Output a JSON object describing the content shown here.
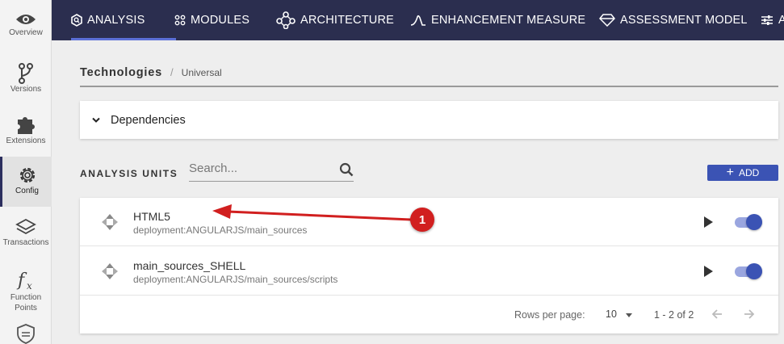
{
  "sidebar": {
    "items": [
      {
        "label": "Overview",
        "icon": "eye-icon"
      },
      {
        "label": "Versions",
        "icon": "branch-icon"
      },
      {
        "label": "Extensions",
        "icon": "puzzle-icon"
      },
      {
        "label": "Config",
        "icon": "gear-icon",
        "active": true
      },
      {
        "label": "Transactions",
        "icon": "layers-icon"
      },
      {
        "label": "Function Points",
        "icon": "fx-icon"
      }
    ]
  },
  "topnav": {
    "tabs": [
      {
        "label": "ANALYSIS",
        "icon": "analysis-icon",
        "active": true
      },
      {
        "label": "MODULES",
        "icon": "modules-icon"
      },
      {
        "label": "ARCHITECTURE",
        "icon": "architecture-icon"
      },
      {
        "label": "ENHANCEMENT MEASURE",
        "icon": "curve-icon"
      },
      {
        "label": "ASSESSMENT MODEL",
        "icon": "diamond-icon"
      },
      {
        "label": "A",
        "icon": "sliders-icon"
      }
    ]
  },
  "breadcrumb": {
    "main": "Technologies",
    "separator": "/",
    "sub": "Universal"
  },
  "dependencies": {
    "title": "Dependencies"
  },
  "analysis_units": {
    "label": "ANALYSIS UNITS",
    "search_placeholder": "Search...",
    "add_label": "ADD",
    "rows": [
      {
        "name": "HTML5",
        "path": "deployment:ANGULARJS/main_sources",
        "enabled": true
      },
      {
        "name": "main_sources_SHELL",
        "path": "deployment:ANGULARJS/main_sources/scripts",
        "enabled": true
      }
    ],
    "footer": {
      "rows_per_page_label": "Rows per page:",
      "rows_per_page": "10",
      "range": "1 - 2 of 2"
    }
  },
  "annotation": {
    "badge": "1"
  },
  "colors": {
    "nav_bg": "#2b2e4f",
    "accent": "#3b53b4",
    "annotation": "#d11f1f"
  }
}
